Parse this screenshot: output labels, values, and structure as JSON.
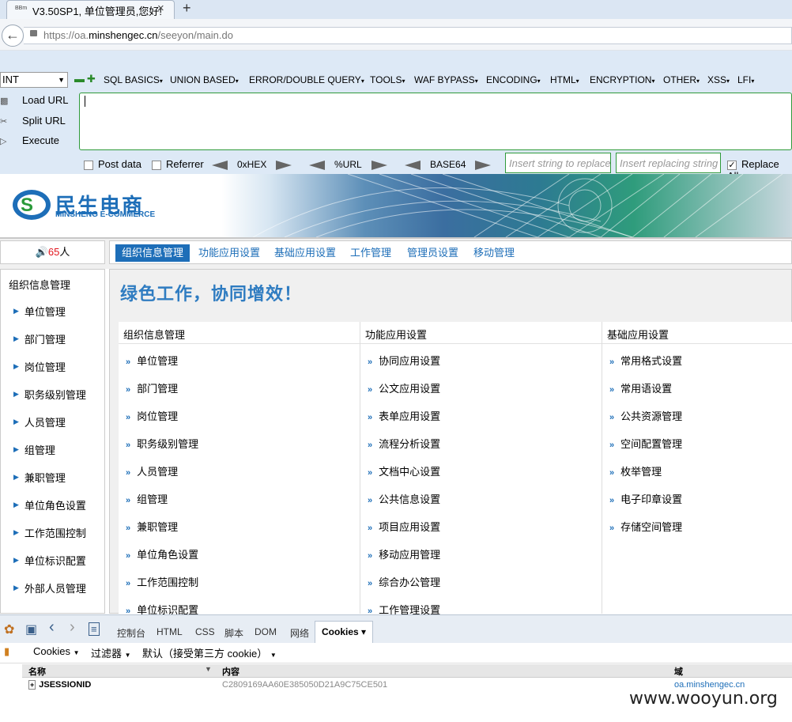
{
  "browser": {
    "tab_icon": "BBm",
    "tab_title": "V3.50SP1, 单位管理员,您好!",
    "tab_close": "×",
    "new_tab": "+",
    "url_prefix": "https://oa.",
    "url_domain": "minshengec.cn",
    "url_path": "/seeyon/main.do"
  },
  "hackbar": {
    "select_value": "INT",
    "menus": [
      "SQL BASICS",
      "UNION BASED",
      "ERROR/DOUBLE QUERY",
      "TOOLS",
      "WAF BYPASS",
      "ENCODING",
      "HTML",
      "ENCRYPTION",
      "OTHER",
      "XSS",
      "LFI"
    ],
    "load_url": "Load URL",
    "split_url": "Split URL",
    "execute": "Execute",
    "post_data": "Post data",
    "referrer": "Referrer",
    "hex": "0xHEX",
    "url": "%URL",
    "base64": "BASE64",
    "insert_placeholder": "Insert string to replace",
    "replace_placeholder": "Insert replacing string",
    "replace_all": "Replace All"
  },
  "banner": {
    "logo_cn": "民生电商",
    "logo_en": "MINSHENG E-COMMERCE"
  },
  "nav": {
    "online_count": "65",
    "online_unit": "人",
    "tabs": [
      "组织信息管理",
      "功能应用设置",
      "基础应用设置",
      "工作管理",
      "管理员设置",
      "移动管理"
    ],
    "active_tab": 0
  },
  "left_menu": {
    "title": "组织信息管理",
    "items": [
      "单位管理",
      "部门管理",
      "岗位管理",
      "职务级别管理",
      "人员管理",
      "组管理",
      "兼职管理",
      "单位角色设置",
      "工作范围控制",
      "单位标识配置",
      "外部人员管理"
    ]
  },
  "main": {
    "slogan": "绿色工作，协同增效！",
    "columns": [
      {
        "title": "组织信息管理",
        "items": [
          "单位管理",
          "部门管理",
          "岗位管理",
          "职务级别管理",
          "人员管理",
          "组管理",
          "兼职管理",
          "单位角色设置",
          "工作范围控制",
          "单位标识配置"
        ]
      },
      {
        "title": "功能应用设置",
        "items": [
          "协同应用设置",
          "公文应用设置",
          "表单应用设置",
          "流程分析设置",
          "文档中心设置",
          "公共信息设置",
          "项目应用设置",
          "移动应用管理",
          "综合办公管理",
          "工作管理设置"
        ]
      },
      {
        "title": "基础应用设置",
        "items": [
          "常用格式设置",
          "常用语设置",
          "公共资源管理",
          "空间配置管理",
          "枚举管理",
          "电子印章设置",
          "存储空间管理"
        ]
      }
    ]
  },
  "devtools": {
    "tabs": [
      "控制台",
      "HTML",
      "CSS",
      "脚本",
      "DOM",
      "网络",
      "Cookies"
    ],
    "active_tab": "Cookies",
    "toolbar": [
      "Cookies",
      "过滤器",
      "默认（接受第三方 cookie）"
    ],
    "columns": [
      "名称",
      "内容",
      "域"
    ],
    "row": {
      "name": "JSESSIONID",
      "value": "C2809169AA60E385050D21A9C75CE501",
      "domain": "oa.minshengec.cn"
    }
  },
  "watermark": "www.wooyun.org",
  "colors": {
    "accent": "#1d6eb8",
    "hackbar_bg": "#dde9f6",
    "green_border": "#2f9a3b"
  }
}
